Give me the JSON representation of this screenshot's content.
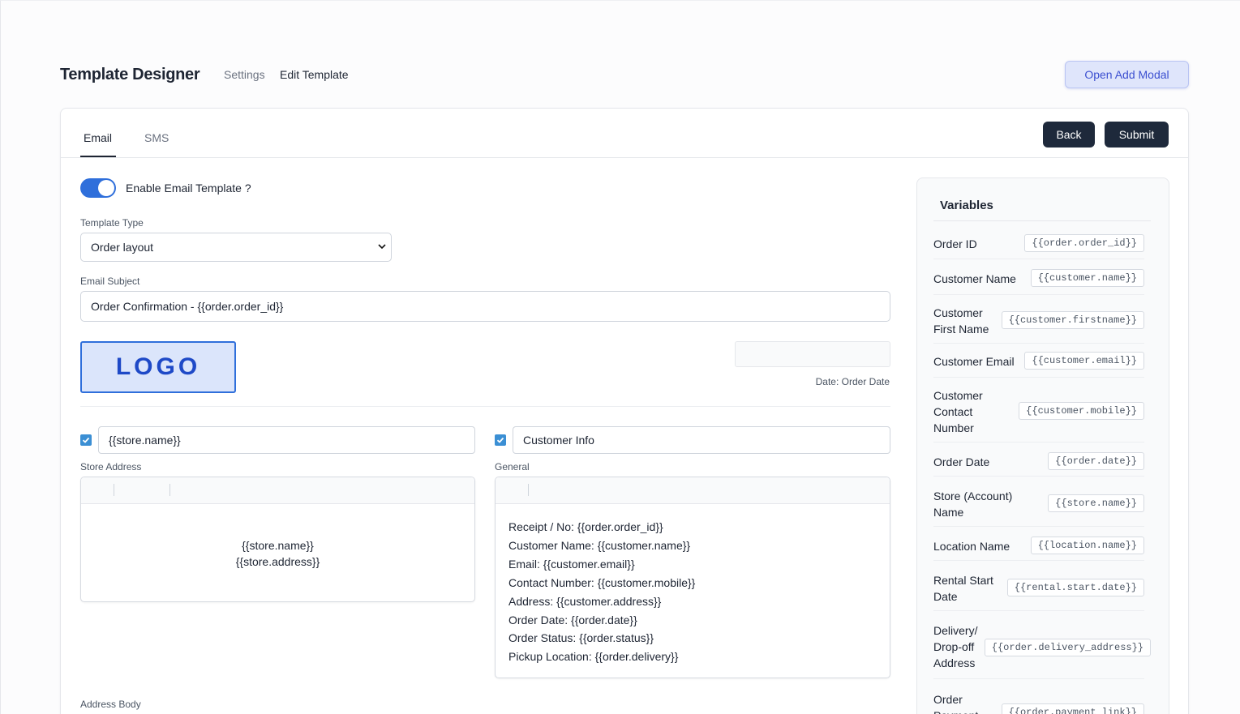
{
  "header": {
    "title": "Template Designer",
    "breadcrumb_settings": "Settings",
    "breadcrumb_edit": "Edit Template",
    "open_modal_label": "Open Add Modal"
  },
  "tabs": [
    {
      "label": "Email",
      "active": true
    },
    {
      "label": "SMS",
      "active": false
    }
  ],
  "actions": {
    "back_label": "Back",
    "submit_label": "Submit"
  },
  "form": {
    "enable_toggle_label": "Enable Email Template ?",
    "enable_toggle_on": true,
    "template_type_label": "Template Type",
    "template_type_value": "Order layout",
    "email_subject_label": "Email Subject",
    "email_subject_value": "Order Confirmation - {{order.order_id}}",
    "logo_text": "LOGO",
    "date_caption": "Date: Order Date",
    "store_name_value": "{{store.name}}",
    "store_name_checked": true,
    "customer_info_value": "Customer Info",
    "customer_info_checked": true,
    "store_address_label": "Store Address",
    "store_address_lines": [
      "{{store.name}}",
      "{{store.address}}"
    ],
    "general_label": "General",
    "general_lines": [
      "Receipt / No: {{order.order_id}}",
      "Customer Name: {{customer.name}}",
      "Email: {{customer.email}}",
      "Contact Number: {{customer.mobile}}",
      "Address: {{customer.address}}",
      "Order Date: {{order.date}}",
      "Order Status: {{order.status}}",
      "Pickup Location: {{order.delivery}}"
    ],
    "address_body_label": "Address Body"
  },
  "variables": {
    "title": "Variables",
    "items": [
      {
        "label": "Order ID",
        "code": "{{order.order_id}}"
      },
      {
        "label": "Customer Name",
        "code": "{{customer.name}}"
      },
      {
        "label": "Customer First Name",
        "code": "{{customer.firstname}}"
      },
      {
        "label": "Customer Email",
        "code": "{{customer.email}}"
      },
      {
        "label": "Customer Contact Number",
        "code": "{{customer.mobile}}"
      },
      {
        "label": "Order Date",
        "code": "{{order.date}}"
      },
      {
        "label": "Store (Account) Name",
        "code": "{{store.name}}"
      },
      {
        "label": "Location Name",
        "code": "{{location.name}}"
      },
      {
        "label": "Rental Start Date",
        "code": "{{rental.start.date}}"
      },
      {
        "label": "Delivery/ Drop-off Address",
        "code": "{{order.delivery_address}}"
      },
      {
        "label": "Order Payment Link",
        "code": "{{order.payment_link}}"
      }
    ]
  },
  "colors": {
    "accent": "#2f6fdb",
    "dark_button": "#1e293b",
    "checkbox": "#3b8fd4"
  }
}
